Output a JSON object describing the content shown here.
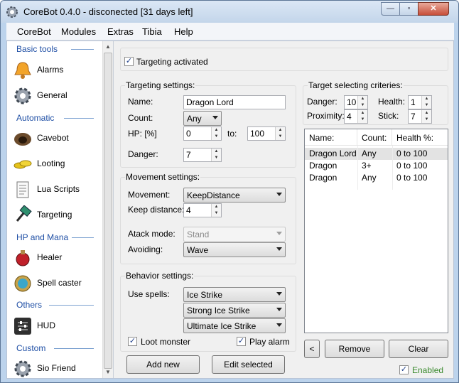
{
  "window": {
    "title": "CoreBot 0.4.0 - disconected [31 days left]"
  },
  "menu": [
    "CoreBot",
    "Modules",
    "Extras",
    "Tibia",
    "Help"
  ],
  "sidebar": {
    "categories": [
      "Basic tools",
      "Automatic",
      "HP and Mana",
      "Others",
      "Custom"
    ],
    "items": [
      {
        "label": "Alarms",
        "icon": "bell-icon"
      },
      {
        "label": "General",
        "icon": "gear-icon"
      },
      {
        "label": "Cavebot",
        "icon": "cave-icon"
      },
      {
        "label": "Looting",
        "icon": "gold-coins-icon"
      },
      {
        "label": "Lua Scripts",
        "icon": "script-scroll-icon"
      },
      {
        "label": "Targeting",
        "icon": "hammer-icon"
      },
      {
        "label": "Healer",
        "icon": "health-potion-icon"
      },
      {
        "label": "Spell caster",
        "icon": "spell-orb-icon"
      },
      {
        "label": "HUD",
        "icon": "sliders-icon"
      },
      {
        "label": "Sio Friend",
        "icon": "gear-icon"
      }
    ]
  },
  "targeting_activated": {
    "label": "Targeting activated",
    "checked": true
  },
  "targeting_settings": {
    "title": "Targeting settings:",
    "name_label": "Name:",
    "name_value": "Dragon Lord",
    "count_label": "Count:",
    "count_value": "Any",
    "hp_label": "HP: [%]",
    "hp_from": "0",
    "to_label": "to:",
    "hp_to": "100",
    "danger_label": "Danger:",
    "danger_value": "7"
  },
  "movement_settings": {
    "title": "Movement settings:",
    "movement_label": "Movement:",
    "movement_value": "KeepDistance",
    "keep_distance_label": "Keep distance:",
    "keep_distance_value": "4",
    "attack_mode_label": "Atack mode:",
    "attack_mode_value": "Stand",
    "avoiding_label": "Avoiding:",
    "avoiding_value": "Wave"
  },
  "behavior_settings": {
    "title": "Behavior settings:",
    "use_spells_label": "Use spells:",
    "spells": [
      "Ice Strike",
      "Strong Ice Strike",
      "Ultimate Ice Strike"
    ],
    "loot_monster": {
      "label": "Loot monster",
      "checked": true
    },
    "play_alarm": {
      "label": "Play alarm",
      "checked": true
    }
  },
  "buttons": {
    "add_new": "Add new",
    "edit_selected": "Edit selected",
    "back": "<",
    "remove": "Remove",
    "clear": "Clear"
  },
  "criteria": {
    "title": "Target selecting criteries:",
    "danger_label": "Danger:",
    "danger_value": "10",
    "health_label": "Health:",
    "health_value": "1",
    "proximity_label": "Proximity:",
    "proximity_value": "4",
    "stick_label": "Stick:",
    "stick_value": "7"
  },
  "target_list": {
    "columns": [
      "Name:",
      "Count:",
      "Health %:"
    ],
    "rows": [
      {
        "name": "Dragon Lord",
        "count": "Any",
        "health": "0 to 100"
      },
      {
        "name": "Dragon",
        "count": "3+",
        "health": "0 to 100"
      },
      {
        "name": "Dragon",
        "count": "Any",
        "health": "0 to 100"
      }
    ]
  },
  "enabled": {
    "label": "Enabled",
    "checked": true,
    "color": "#3a8a2e"
  },
  "colors": {
    "category": "#1f4fa5",
    "title_bar": "#c3d5ea",
    "close_button": "#c74e3a"
  }
}
